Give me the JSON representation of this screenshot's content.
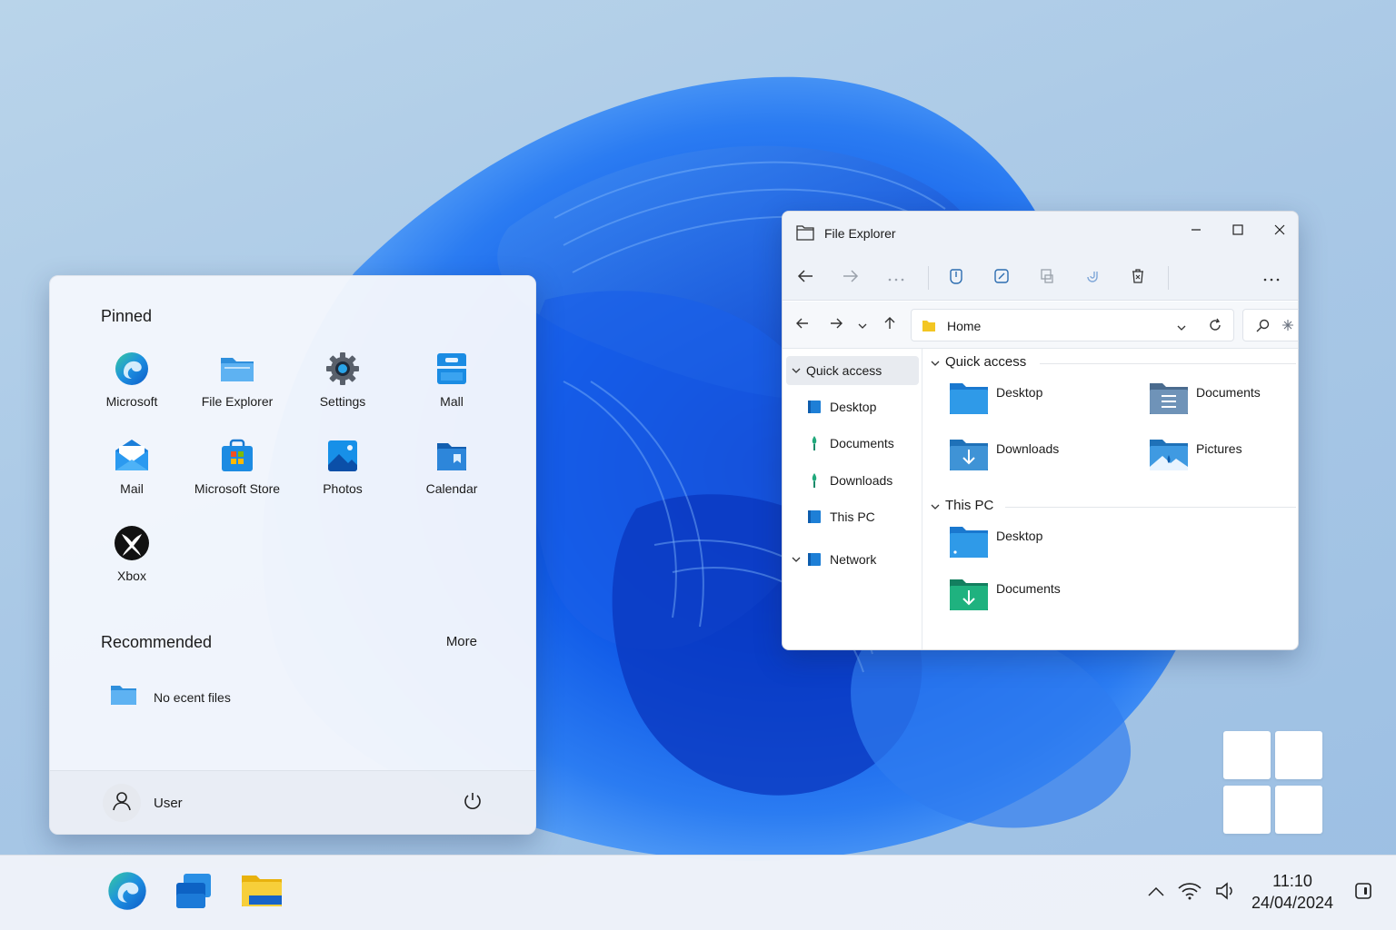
{
  "start_menu": {
    "pinned_title": "Pinned",
    "pinned_apps": [
      {
        "label": "Microsoft",
        "icon": "edge-icon"
      },
      {
        "label": "File Explorer",
        "icon": "file-explorer-icon"
      },
      {
        "label": "Settings",
        "icon": "gear-icon"
      },
      {
        "label": "Mall",
        "icon": "mail-app-icon"
      },
      {
        "label": "Mail",
        "icon": "envelope-icon"
      },
      {
        "label": "Microsoft Store",
        "icon": "store-bag-icon"
      },
      {
        "label": "Photos",
        "icon": "photos-icon"
      },
      {
        "label": "Calendar",
        "icon": "calendar-icon"
      },
      {
        "label": "Xbox",
        "icon": "xbox-icon"
      }
    ],
    "recommended_title": "Recommended",
    "more_label": "More",
    "recommended_empty": "No ecent files",
    "user_name": "User"
  },
  "file_explorer": {
    "title": "File Explorer",
    "address": "Home",
    "sidebar": [
      {
        "label": "Quick access",
        "icon": "chevron-down-icon"
      },
      {
        "label": "Desktop",
        "icon": "desktop-icon"
      },
      {
        "label": "Documents",
        "icon": "documents-icon"
      },
      {
        "label": "Downloads",
        "icon": "downloads-icon"
      },
      {
        "label": "This PC",
        "icon": "pc-icon"
      },
      {
        "label": "Network",
        "icon": "network-icon"
      }
    ],
    "groups": {
      "quick_access": {
        "title": "Quick access",
        "items": [
          "Desktop",
          "Documents",
          "Downloads",
          "Pictures"
        ]
      },
      "this_pc": {
        "title": "This PC",
        "items": [
          "Desktop",
          "Documents"
        ]
      }
    }
  },
  "taskbar": {
    "apps": [
      "edge-icon",
      "widgets-icon",
      "file-explorer-icon"
    ],
    "tray": [
      "chevron-up-icon",
      "wifi-icon",
      "volume-icon"
    ],
    "time": "11:10",
    "date": "24/04/2024"
  },
  "colors": {
    "accent": "#0a5fd6",
    "folder_blue": "#2f8fdc",
    "folder_yellow": "#f3c623",
    "folder_green": "#1aa37a"
  }
}
